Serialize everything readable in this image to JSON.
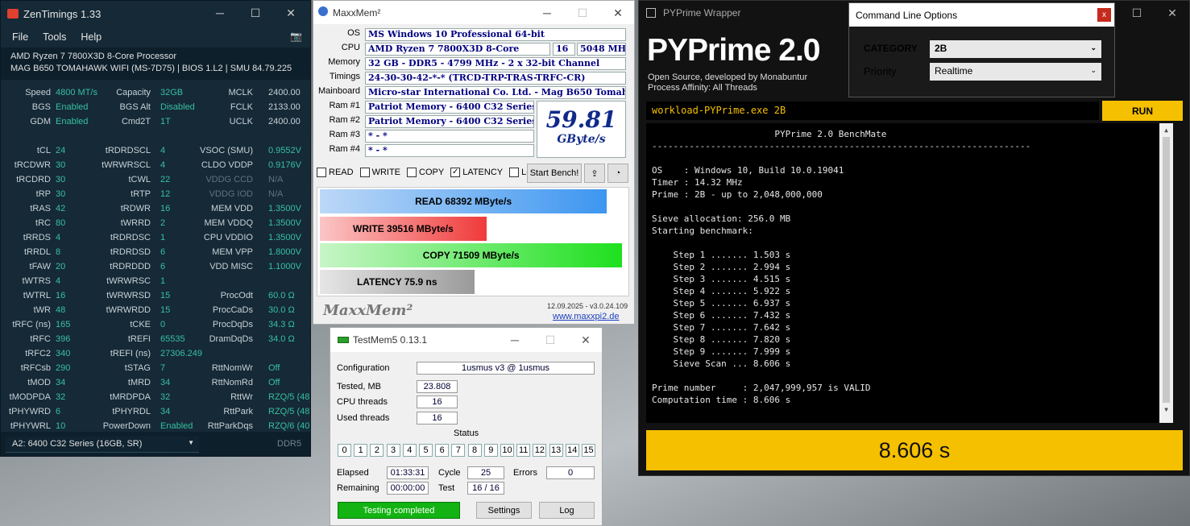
{
  "zentimings": {
    "title": "ZenTimings 1.33",
    "menu": [
      "File",
      "Tools",
      "Help"
    ],
    "cpu": "AMD Ryzen 7 7800X3D 8-Core Processor",
    "board": "MAG B650 TOMAHAWK WIFI (MS-7D75) | BIOS 1.L2 | SMU 84.79.225",
    "rows": [
      [
        "Speed",
        "4800 MT/s",
        "Capacity",
        "32GB",
        "MCLK",
        "2400.00"
      ],
      [
        "BGS",
        "Enabled",
        "BGS Alt",
        "Disabled",
        "FCLK",
        "2133.00"
      ],
      [
        "GDM",
        "Enabled",
        "Cmd2T",
        "1T",
        "UCLK",
        "2400.00"
      ],
      [
        "",
        "",
        "",
        "",
        "",
        ""
      ],
      [
        "tCL",
        "24",
        "tRDRDSCL",
        "4",
        "VSOC (SMU)",
        "0.9552V"
      ],
      [
        "tRCDWR",
        "30",
        "tWRWRSCL",
        "4",
        "CLDO VDDP",
        "0.9176V"
      ],
      [
        "tRCDRD",
        "30",
        "tCWL",
        "22",
        "VDDG CCD",
        "N/A"
      ],
      [
        "tRP",
        "30",
        "tRTP",
        "12",
        "VDDG IOD",
        "N/A"
      ],
      [
        "tRAS",
        "42",
        "tRDWR",
        "16",
        "MEM VDD",
        "1.3500V"
      ],
      [
        "tRC",
        "80",
        "tWRRD",
        "2",
        "MEM VDDQ",
        "1.3500V"
      ],
      [
        "tRRDS",
        "4",
        "tRDRDSC",
        "1",
        "CPU VDDIO",
        "1.3500V"
      ],
      [
        "tRRDL",
        "8",
        "tRDRDSD",
        "6",
        "MEM VPP",
        "1.8000V"
      ],
      [
        "tFAW",
        "20",
        "tRDRDDD",
        "6",
        "VDD MISC",
        "1.1000V"
      ],
      [
        "tWTRS",
        "4",
        "tWRWRSC",
        "1",
        "",
        ""
      ],
      [
        "tWTRL",
        "16",
        "tWRWRSD",
        "15",
        "ProcOdt",
        "60.0 Ω"
      ],
      [
        "tWR",
        "48",
        "tWRWRDD",
        "15",
        "ProcCaDs",
        "30.0 Ω"
      ],
      [
        "tRFC (ns)",
        "165",
        "tCKE",
        "0",
        "ProcDqDs",
        "34.3 Ω"
      ],
      [
        "tRFC",
        "396",
        "tREFI",
        "65535",
        "DramDqDs",
        "34.0 Ω"
      ],
      [
        "tRFC2",
        "340",
        "tREFI (ns)",
        "27306.249",
        "",
        ""
      ],
      [
        "tRFCsb",
        "290",
        "tSTAG",
        "7",
        "RttNomWr",
        "Off"
      ],
      [
        "tMOD",
        "34",
        "tMRD",
        "34",
        "RttNomRd",
        "Off"
      ],
      [
        "tMODPDA",
        "32",
        "tMRDPDA",
        "32",
        "RttWr",
        "RZQ/5 (48)"
      ],
      [
        "tPHYWRD",
        "6",
        "tPHYRDL",
        "34",
        "RttPark",
        "RZQ/5 (48)"
      ],
      [
        "tPHYWRL",
        "10",
        "PowerDown",
        "Enabled",
        "RttParkDqs",
        "RZQ/6 (40)"
      ]
    ],
    "module_select": "A2: 6400 C32 Series (16GB, SR)",
    "mem_type": "DDR5"
  },
  "maxxmem": {
    "title": "MaxxMem²",
    "os_label": "OS",
    "os": "MS Windows 10 Professional 64-bit",
    "cpu_label": "CPU",
    "cpu": "AMD Ryzen 7 7800X3D 8-Core",
    "cores": "16",
    "freq": "5048 MHz",
    "mem_label": "Memory",
    "memory": "32 GB - DDR5 - 4799 MHz - 2 x 32-bit Channel",
    "tim_label": "Timings",
    "timings": "24-30-30-42-*-* (TRCD-TRP-TRAS-TRFC-CR)",
    "mb_label": "Mainboard",
    "mainboard": "Micro-star International Co. Ltd. - Mag B650 Tomahawk Wi",
    "ram": [
      [
        "Ram #1",
        "Patriot Memory - 6400 C32 Series"
      ],
      [
        "Ram #2",
        "Patriot Memory - 6400 C32 Series"
      ],
      [
        "Ram #3",
        "* - *"
      ],
      [
        "Ram #4",
        "* - *"
      ]
    ],
    "score": "59.81",
    "score_unit": "GByte/s",
    "checks": [
      [
        "READ",
        false
      ],
      [
        "WRITE",
        false
      ],
      [
        "COPY",
        false
      ],
      [
        "LATENCY",
        true
      ],
      [
        "LOG!",
        false
      ]
    ],
    "start": "Start Bench!",
    "read": "READ 68392 MByte/s",
    "write": "WRITE 39516 MByte/s",
    "copy": "COPY 71509 MByte/s",
    "latency": "LATENCY 75.9 ns",
    "read_frac": 0.93,
    "write_frac": 0.54,
    "copy_frac": 0.98,
    "latency_frac": 0.5,
    "logo": "MaxxMem²",
    "date": "12.09.2025 - v3.0.24.109",
    "url": "www.maxxpi2.de"
  },
  "testmem": {
    "title": "TestMem5  0.13.1",
    "config_label": "Configuration",
    "config": "1usmus v3 @ 1usmus",
    "tested_label": "Tested, MB",
    "tested": "23.808",
    "cpu_label": "CPU threads",
    "cpu_threads": "16",
    "used_label": "Used threads",
    "used_threads": "16",
    "status_label": "Status",
    "cells": [
      "0",
      "1",
      "2",
      "3",
      "4",
      "5",
      "6",
      "7",
      "8",
      "9",
      "10",
      "11",
      "12",
      "13",
      "14",
      "15"
    ],
    "elapsed_label": "Elapsed",
    "elapsed": "01:33:31",
    "cycle_label": "Cycle",
    "cycle": "25",
    "errors_label": "Errors",
    "errors": "0",
    "remaining_label": "Remaining",
    "remaining": "00:00:00",
    "test_label": "Test",
    "test": "16 / 16",
    "done": "Testing completed",
    "settings": "Settings",
    "log": "Log"
  },
  "pyprime": {
    "title": "PYPrime Wrapper",
    "heading": "PYPrime 2.0",
    "sub1": "Open Source, developed by Monabuntur",
    "sub2": "Process Affinity: All Threads",
    "cmd_title": "Command Line Options",
    "category_label": "CATEGORY",
    "category": "2B",
    "priority_label": "Priority",
    "priority": "Realtime",
    "command": "workload-PYPrime.exe 2B",
    "run": "RUN",
    "output": "                       PYPrime 2.0 BenchMate\n-----------------------------------------------------------------------\n\nOS    : Windows 10, Build 10.0.19041\nTimer : 14.32 MHz\nPrime : 2B - up to 2,048,000,000\n\nSieve allocation: 256.0 MB\nStarting benchmark:\n\n    Step 1 ....... 1.503 s\n    Step 2 ....... 2.994 s\n    Step 3 ....... 4.515 s\n    Step 4 ....... 5.922 s\n    Step 5 ....... 6.937 s\n    Step 6 ....... 7.432 s\n    Step 7 ....... 7.642 s\n    Step 8 ....... 7.820 s\n    Step 9 ....... 7.999 s\n    Sieve Scan ... 8.606 s\n\nPrime number     : 2,047,999,957 is VALID\nComputation time : 8.606 s",
    "result": "8.606 s"
  }
}
